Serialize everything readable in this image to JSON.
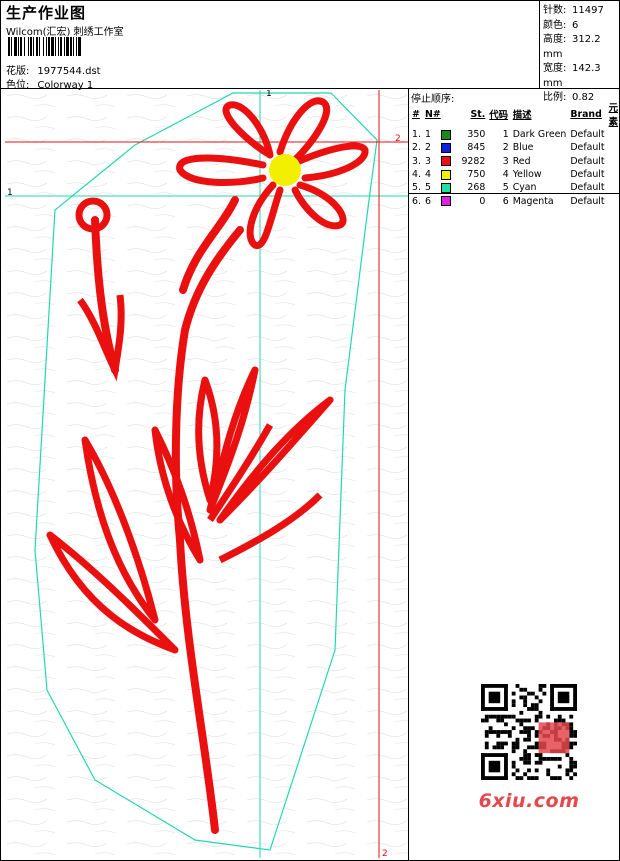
{
  "header": {
    "title": "生产作业图",
    "company": "Wilcom(汇宏) 刺绣工作室",
    "design_label": "花版:",
    "design_file": "1977544.dst",
    "colorway_label": "色位:",
    "colorway": "Colorway 1"
  },
  "stats": [
    {
      "label": "针数:",
      "value": "11497"
    },
    {
      "label": "颜色:",
      "value": "6"
    },
    {
      "label": "高度:",
      "value": "312.2 mm"
    },
    {
      "label": "宽度:",
      "value": "142.3 mm"
    },
    {
      "label": "比例:",
      "value": "0.82"
    }
  ],
  "stop_sequence": {
    "title": "停止顺序:",
    "headers": [
      "#",
      "N#",
      "St.",
      "代码",
      "描述",
      "Brand",
      "元素"
    ],
    "rows": [
      {
        "num": "1.",
        "n": "1",
        "st": "350",
        "code": "1",
        "desc": "Dark Green",
        "brand": "Default",
        "color": "#1a8a1a"
      },
      {
        "num": "2.",
        "n": "2",
        "st": "845",
        "code": "2",
        "desc": "Blue",
        "brand": "Default",
        "color": "#1020e0"
      },
      {
        "num": "3.",
        "n": "3",
        "st": "9282",
        "code": "3",
        "desc": "Red",
        "brand": "Default",
        "color": "#e81010"
      },
      {
        "num": "4.",
        "n": "4",
        "st": "750",
        "code": "4",
        "desc": "Yellow",
        "brand": "Default",
        "color": "#f0f000"
      },
      {
        "num": "5.",
        "n": "5",
        "st": "268",
        "code": "5",
        "desc": "Cyan",
        "brand": "Default",
        "color": "#20e0a0"
      },
      {
        "num": "6.",
        "n": "6",
        "st": "0",
        "code": "6",
        "desc": "Magenta",
        "brand": "Default",
        "color": "#e020e0"
      }
    ]
  },
  "guides": {
    "marker_1": "1",
    "marker_2": "2"
  },
  "watermark": {
    "site": "6xiu.com"
  }
}
